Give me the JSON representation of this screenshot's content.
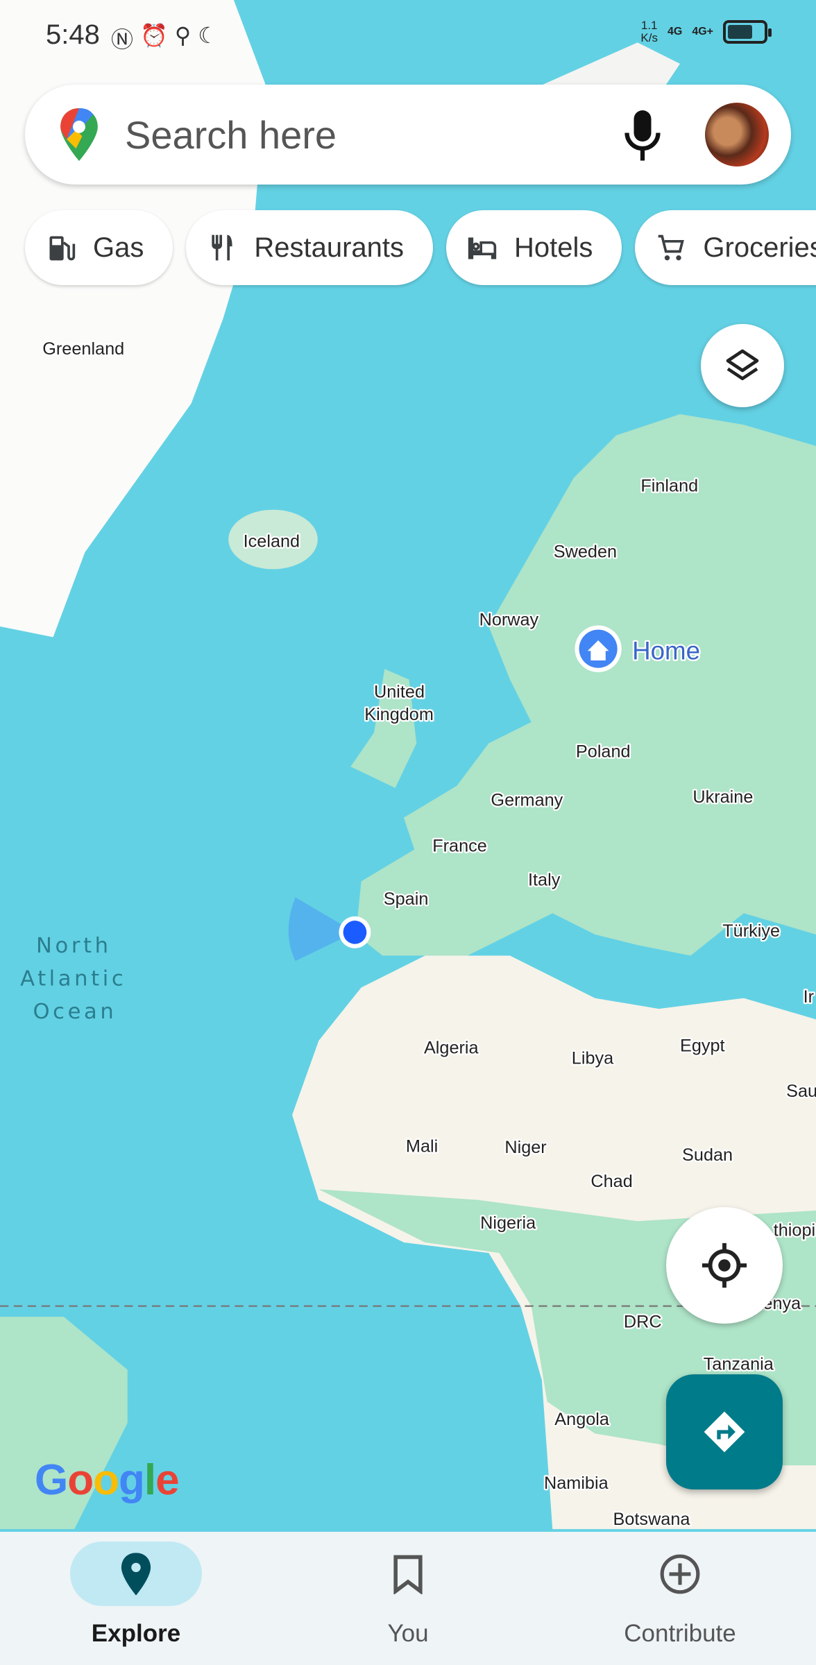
{
  "status_bar": {
    "time": "5:48",
    "speed": "1.1",
    "speed_unit": "K/s",
    "net1": "4G",
    "net2": "4G+",
    "battery_level": 0.7
  },
  "search": {
    "placeholder": "Search here"
  },
  "chips": [
    {
      "label": "Gas",
      "icon": "gas-station-icon"
    },
    {
      "label": "Restaurants",
      "icon": "restaurant-icon"
    },
    {
      "label": "Hotels",
      "icon": "hotel-bed-icon"
    },
    {
      "label": "Groceries",
      "icon": "cart-icon"
    }
  ],
  "map": {
    "labels": {
      "greenland": "Greenland",
      "iceland": "Iceland",
      "finland": "Finland",
      "sweden": "Sweden",
      "norway": "Norway",
      "uk1": "United",
      "uk2": "Kingdom",
      "poland": "Poland",
      "germany": "Germany",
      "ukraine": "Ukraine",
      "france": "France",
      "italy": "Italy",
      "spain": "Spain",
      "turkiye": "Türkiye",
      "algeria": "Algeria",
      "libya": "Libya",
      "egypt": "Egypt",
      "mali": "Mali",
      "niger": "Niger",
      "sudan": "Sudan",
      "chad": "Chad",
      "nigeria": "Nigeria",
      "drc": "DRC",
      "tanzania": "Tanzania",
      "angola": "Angola",
      "namibia": "Namibia",
      "botswana": "Botswana",
      "iran": "Ir",
      "saudi": "Sau",
      "ethiopia": "thiopi",
      "kenya": "enya"
    },
    "ocean": [
      "North",
      "Atlantic",
      "Ocean"
    ],
    "home_label": "Home",
    "attribution": "Google",
    "colors": {
      "water": "#63d1e4",
      "land_green": "#aee4c8",
      "land_desert": "#f6f3ea",
      "accent": "#007b8a"
    }
  },
  "nav": {
    "items": [
      {
        "label": "Explore",
        "active": true
      },
      {
        "label": "You"
      },
      {
        "label": "Contribute"
      }
    ]
  }
}
